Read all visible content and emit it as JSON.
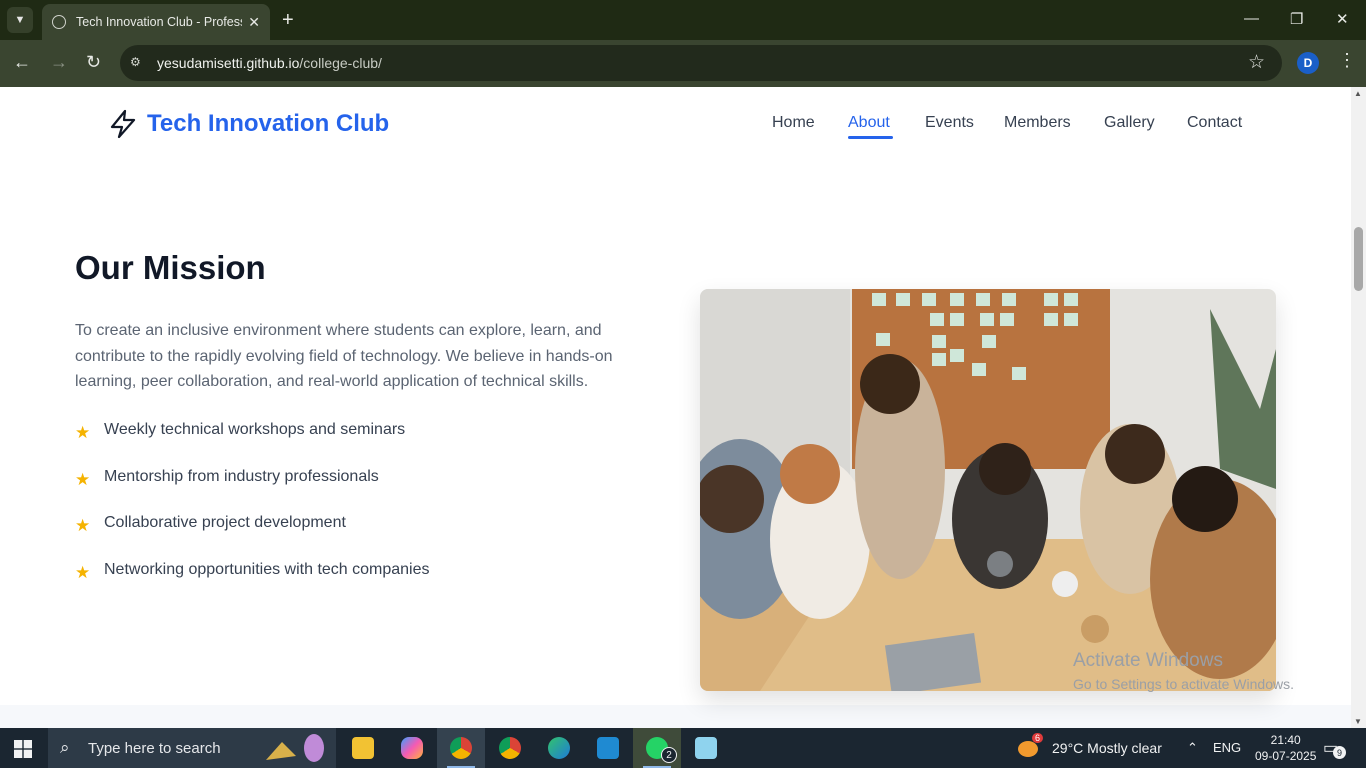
{
  "browser": {
    "tab_title": "Tech Innovation Club - Professional",
    "tab_close": "✕",
    "new_tab": "+",
    "url_host": "yesudamisetti.github.io",
    "url_path": "/college-club/",
    "profile_initial": "D"
  },
  "site": {
    "logo_text": "Tech Innovation Club",
    "nav": [
      "Home",
      "About",
      "Events",
      "Members",
      "Gallery",
      "Contact"
    ],
    "active_nav": "About"
  },
  "mission": {
    "title": "Our Mission",
    "text": "To create an inclusive environment where students can explore, learn, and contribute to the rapidly evolving field of technology. We believe in hands-on learning, peer collaboration, and real-world application of technical skills.",
    "features": [
      "Weekly technical workshops and seminars",
      "Mentorship from industry professionals",
      "Collaborative project development",
      "Networking opportunities with tech companies"
    ]
  },
  "watermark": {
    "line1": "Activate Windows",
    "line2": "Go to Settings to activate Windows."
  },
  "taskbar": {
    "search_placeholder": "Type here to search",
    "weather": "29°C  Mostly clear",
    "weather_badge": "6",
    "language": "ENG",
    "time": "21:40",
    "date": "09-07-2025",
    "whatsapp_badge": "2",
    "notification_count": "9"
  },
  "colors": {
    "brand": "#2563eb",
    "star": "#f5b301",
    "tabbar": "#1f2a14",
    "taskbar": "#1b2631"
  }
}
